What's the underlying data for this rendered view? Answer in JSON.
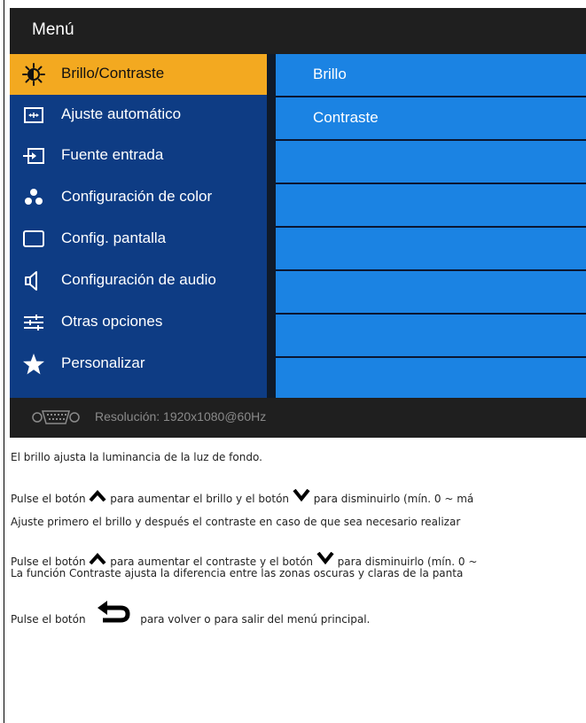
{
  "osd": {
    "title": "Menú",
    "menu_items": [
      {
        "label": "Brillo/Contraste",
        "icon": "brightness-icon",
        "selected": true
      },
      {
        "label": "Ajuste automático",
        "icon": "auto-adjust-icon",
        "selected": false
      },
      {
        "label": "Fuente entrada",
        "icon": "input-source-icon",
        "selected": false
      },
      {
        "label": "Configuración de color",
        "icon": "color-dots-icon",
        "selected": false
      },
      {
        "label": "Config. pantalla",
        "icon": "display-icon",
        "selected": false
      },
      {
        "label": "Configuración de audio",
        "icon": "speaker-icon",
        "selected": false
      },
      {
        "label": "Otras opciones",
        "icon": "sliders-icon",
        "selected": false
      },
      {
        "label": "Personalizar",
        "icon": "star-icon",
        "selected": false
      }
    ],
    "submenu_items": [
      {
        "label": "Brillo"
      },
      {
        "label": "Contraste"
      },
      {
        "label": ""
      },
      {
        "label": ""
      },
      {
        "label": ""
      },
      {
        "label": ""
      },
      {
        "label": ""
      },
      {
        "label": ""
      }
    ],
    "footer": {
      "icon": "vga-connector-icon",
      "text": "Resolución: 1920x1080@60Hz"
    },
    "colors": {
      "header_bg": "#1f1f1f",
      "menu_bg": "#0e3c84",
      "selected_bg": "#f3a920",
      "submenu_bg": "#1b83e3",
      "footer_text": "#8a8a8a"
    }
  },
  "doc": {
    "line1": "El brillo ajusta la luminancia de la luz de fondo.",
    "line2_pre": "Pulse el botón",
    "line2_mid": "para aumentar el brillo y el botón",
    "line2_post": "para disminuirlo (mín. 0 ~ má",
    "line3": "Ajuste primero el brillo y después el contraste en caso de que sea necesario realizar",
    "line4_pre": "Pulse el botón",
    "line4_mid": "para aumentar el contraste y el botón",
    "line4_post": "para disminuirlo (mín. 0 ~",
    "line5": "La función Contraste ajusta la diferencia entre las zonas oscuras y claras de la panta",
    "line6_pre": "Pulse el botón",
    "line6_post": "para volver o para salir del menú principal.",
    "icons": [
      "up-arrow-icon",
      "down-arrow-icon",
      "back-arrow-icon"
    ]
  }
}
